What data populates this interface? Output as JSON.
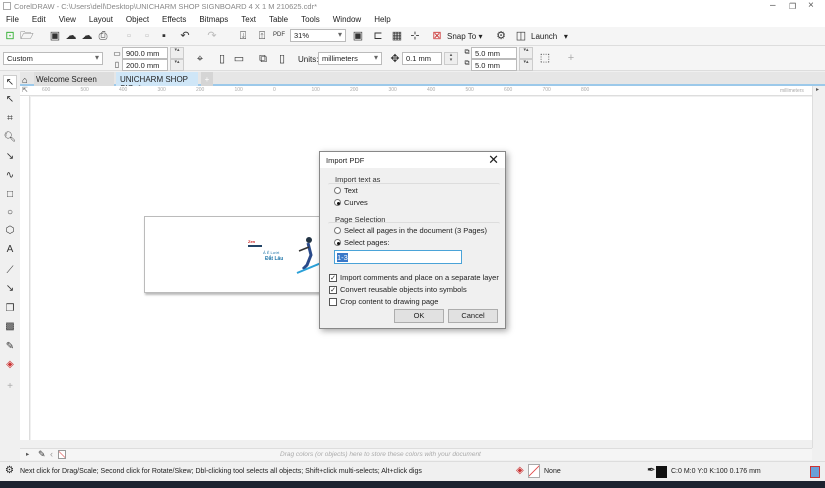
{
  "window": {
    "title": "CorelDRAW - C:\\Users\\dell\\Desktop\\UNICHARM SHOP SIGNBOARD 4 X 1 M 210625.cdr*"
  },
  "menu": [
    "File",
    "Edit",
    "View",
    "Layout",
    "Object",
    "Effects",
    "Bitmaps",
    "Text",
    "Table",
    "Tools",
    "Window",
    "Help"
  ],
  "toolbar": {
    "zoom": "31%",
    "snap_to": "Snap To",
    "launch": "Launch",
    "pdf_label": "PDF"
  },
  "propbar": {
    "preset": "Custom",
    "width": "900.0 mm",
    "height": "200.0 mm",
    "units_label": "Units:",
    "units": "millimeters",
    "nudge": "0.1 mm",
    "dup_x": "5.0 mm",
    "dup_y": "5.0 mm"
  },
  "tabs": [
    {
      "label": "Welcome Screen"
    },
    {
      "label": "UNICHARM SHOP SIG..*"
    }
  ],
  "ruler": {
    "ticks": [
      "600",
      "500",
      "400",
      "300",
      "200",
      "100",
      "0",
      "100",
      "200",
      "300",
      "400",
      "500",
      "600",
      "700",
      "800"
    ],
    "unit": "millimeters"
  },
  "artwork": {
    "line1": "Zen",
    "line2": "Ả Ẻ Lướt",
    "line3": "Đắt Lâu"
  },
  "dialog": {
    "title": "Import PDF",
    "text_group": "Import text as",
    "text_options": [
      {
        "label": "Text",
        "selected": false
      },
      {
        "label": "Curves",
        "selected": true
      }
    ],
    "page_group": "Page Selection",
    "page_options": [
      {
        "label": "Select all pages in the document (3 Pages)",
        "selected": false
      },
      {
        "label": "Select pages:",
        "selected": true
      }
    ],
    "pages_value": "1-3",
    "checks": [
      {
        "label": "Import comments and place on a separate layer",
        "checked": true
      },
      {
        "label": "Convert reusable objects into symbols",
        "checked": true
      },
      {
        "label": "Crop content to drawing page",
        "checked": false
      }
    ],
    "ok": "OK",
    "cancel": "Cancel"
  },
  "palette_hint": "Drag colors (or objects) here to store these colors with your document",
  "status": {
    "hint": "Next click for Drag/Scale; Second click for Rotate/Skew; Dbl-clicking tool selects all objects; Shift+click multi-selects; Alt+click digs",
    "fill": "None",
    "outline": "C:0 M:0 Y:0 K:100  0.176 mm"
  }
}
